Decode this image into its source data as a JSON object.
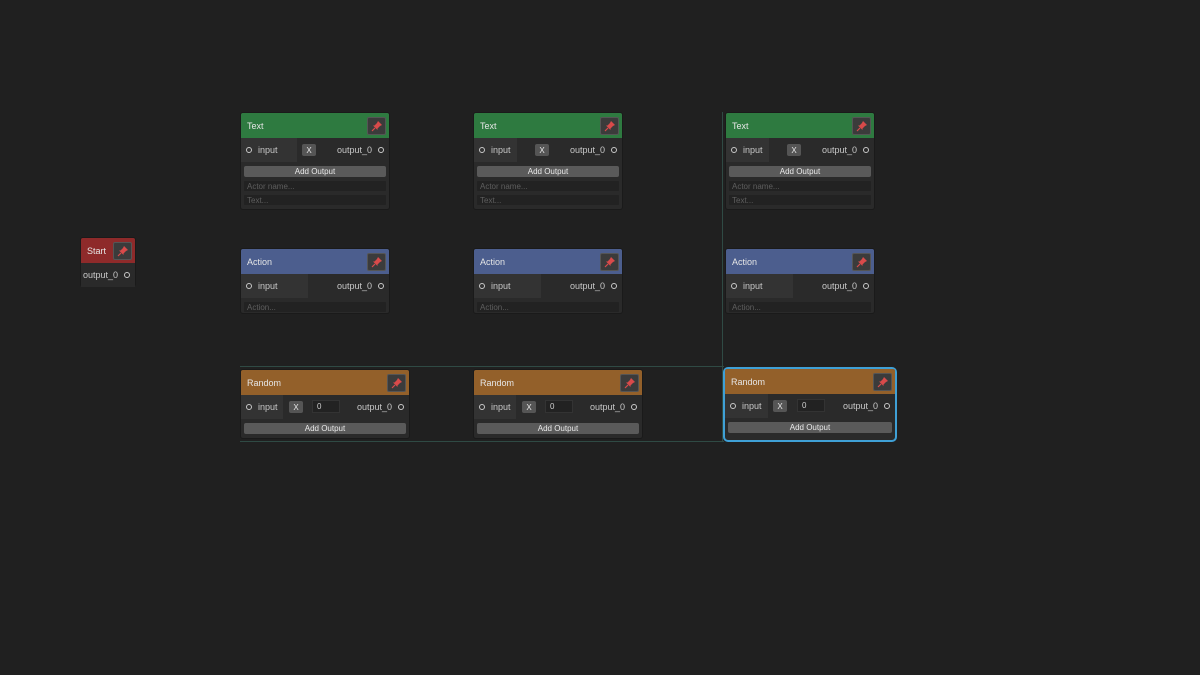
{
  "colors": {
    "canvas_bg": "#202020",
    "text_header": "#2e7a40",
    "action_header": "#4c5e8e",
    "random_header": "#93602a",
    "start_header": "#8e2a2a",
    "selection": "#3fa0d6"
  },
  "icons": {
    "pin": "pin-icon"
  },
  "start": {
    "title": "Start",
    "output": "output_0"
  },
  "text_nodes": [
    {
      "title": "Text",
      "input": "input",
      "x_label": "X",
      "output": "output_0",
      "add_output": "Add Output",
      "actor_placeholder": "Actor name...",
      "text_placeholder": "Text..."
    },
    {
      "title": "Text",
      "input": "input",
      "x_label": "X",
      "output": "output_0",
      "add_output": "Add Output",
      "actor_placeholder": "Actor name...",
      "text_placeholder": "Text..."
    },
    {
      "title": "Text",
      "input": "input",
      "x_label": "X",
      "output": "output_0",
      "add_output": "Add Output",
      "actor_placeholder": "Actor name...",
      "text_placeholder": "Text..."
    }
  ],
  "action_nodes": [
    {
      "title": "Action",
      "input": "input",
      "output": "output_0",
      "action_placeholder": "Action..."
    },
    {
      "title": "Action",
      "input": "input",
      "output": "output_0",
      "action_placeholder": "Action..."
    },
    {
      "title": "Action",
      "input": "input",
      "output": "output_0",
      "action_placeholder": "Action..."
    }
  ],
  "random_nodes": [
    {
      "title": "Random",
      "input": "input",
      "x_label": "X",
      "weight": "0",
      "output": "output_0",
      "add_output": "Add Output",
      "selected": false
    },
    {
      "title": "Random",
      "input": "input",
      "x_label": "X",
      "weight": "0",
      "output": "output_0",
      "add_output": "Add Output",
      "selected": false
    },
    {
      "title": "Random",
      "input": "input",
      "x_label": "X",
      "weight": "0",
      "output": "output_0",
      "add_output": "Add Output",
      "selected": true
    }
  ]
}
